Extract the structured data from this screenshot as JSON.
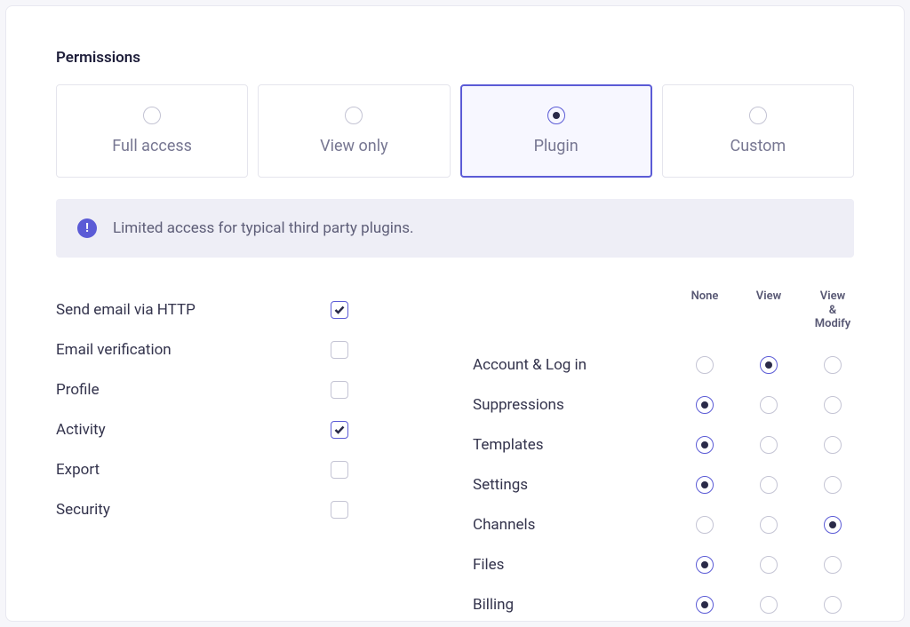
{
  "section_title": "Permissions",
  "modes": [
    {
      "label": "Full access",
      "selected": false
    },
    {
      "label": "View only",
      "selected": false
    },
    {
      "label": "Plugin",
      "selected": true
    },
    {
      "label": "Custom",
      "selected": false
    }
  ],
  "banner": {
    "icon": "!",
    "text": "Limited access for typical third party plugins."
  },
  "column_headers": [
    "None",
    "View",
    "View & Modify"
  ],
  "left_permissions": [
    {
      "label": "Send email via HTTP",
      "checked": true
    },
    {
      "label": "Email verification",
      "checked": false
    },
    {
      "label": "Profile",
      "checked": false
    },
    {
      "label": "Activity",
      "checked": true
    },
    {
      "label": "Export",
      "checked": false
    },
    {
      "label": "Security",
      "checked": false
    }
  ],
  "right_permissions": [
    {
      "label": "Account & Log in",
      "value": "view"
    },
    {
      "label": "Suppressions",
      "value": "none"
    },
    {
      "label": "Templates",
      "value": "none"
    },
    {
      "label": "Settings",
      "value": "none"
    },
    {
      "label": "Channels",
      "value": "modify"
    },
    {
      "label": "Files",
      "value": "none"
    },
    {
      "label": "Billing",
      "value": "none"
    }
  ]
}
